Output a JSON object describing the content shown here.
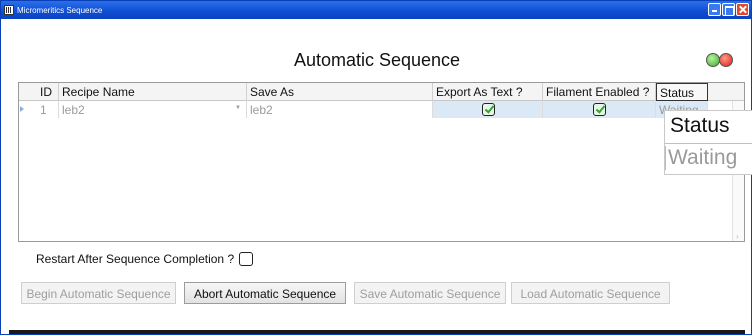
{
  "window": {
    "title": "Micromeritics Sequence"
  },
  "heading": "Automatic Sequence",
  "grid": {
    "columns": [
      "ID",
      "Recipe Name",
      "Save As",
      "Export As Text ?",
      "Filament Enabled ?",
      "Status"
    ],
    "rows": [
      {
        "id": "1",
        "recipe_name": "leb2",
        "save_as": "leb2",
        "export_as_text": true,
        "filament_enabled": true,
        "status": "Waiting"
      }
    ]
  },
  "tooltip": {
    "header": "Status",
    "value": "Waiting"
  },
  "restart_label": "Restart After Sequence Completion ?",
  "restart_checked": false,
  "buttons": {
    "begin": "Begin Automatic Sequence",
    "abort": "Abort Automatic Sequence",
    "save": "Save Automatic Sequence",
    "load": "Load Automatic Sequence"
  },
  "colors": {
    "titlebar": "#0f4dd2",
    "selected_row": "#dbe9f6",
    "disabled_text": "#9a9a9a"
  },
  "icons": [
    "app-icon",
    "minimize-icon",
    "maximize-icon",
    "close-icon",
    "row-indicator-icon",
    "dropdown-arrow-icon",
    "green-light-icon",
    "red-light-icon"
  ]
}
